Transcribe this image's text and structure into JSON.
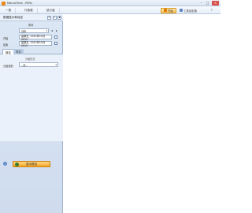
{
  "window": {
    "title": "MarcoTime - Pilfin",
    "minimize": "–",
    "maximize": "□",
    "close": "×"
  },
  "menu": {
    "tabs": [
      "一般",
      "行政费",
      "统计量"
    ],
    "active_button": "开始",
    "right_item_1": "工具设定值",
    "right_item_2": "?"
  },
  "sidebar": {
    "header_title": "数据显示和设定",
    "section_label": "期间",
    "period_select": "月份",
    "start_label": "开始",
    "start_value": "星期五, 2012年10月 2012",
    "end_label": "结束",
    "end_value": "星期五, 2012年10月 2012",
    "tabs": [
      "报告",
      "项目"
    ],
    "group_label": "分组形式",
    "group_field_label": "分组类别",
    "group_select": "--无--",
    "run_button": "显示报告",
    "help": "?"
  },
  "colors": {
    "accent": "#f5a623",
    "sidebar_bg": "#cfdcee",
    "titlebar": "#dbe5f1"
  }
}
